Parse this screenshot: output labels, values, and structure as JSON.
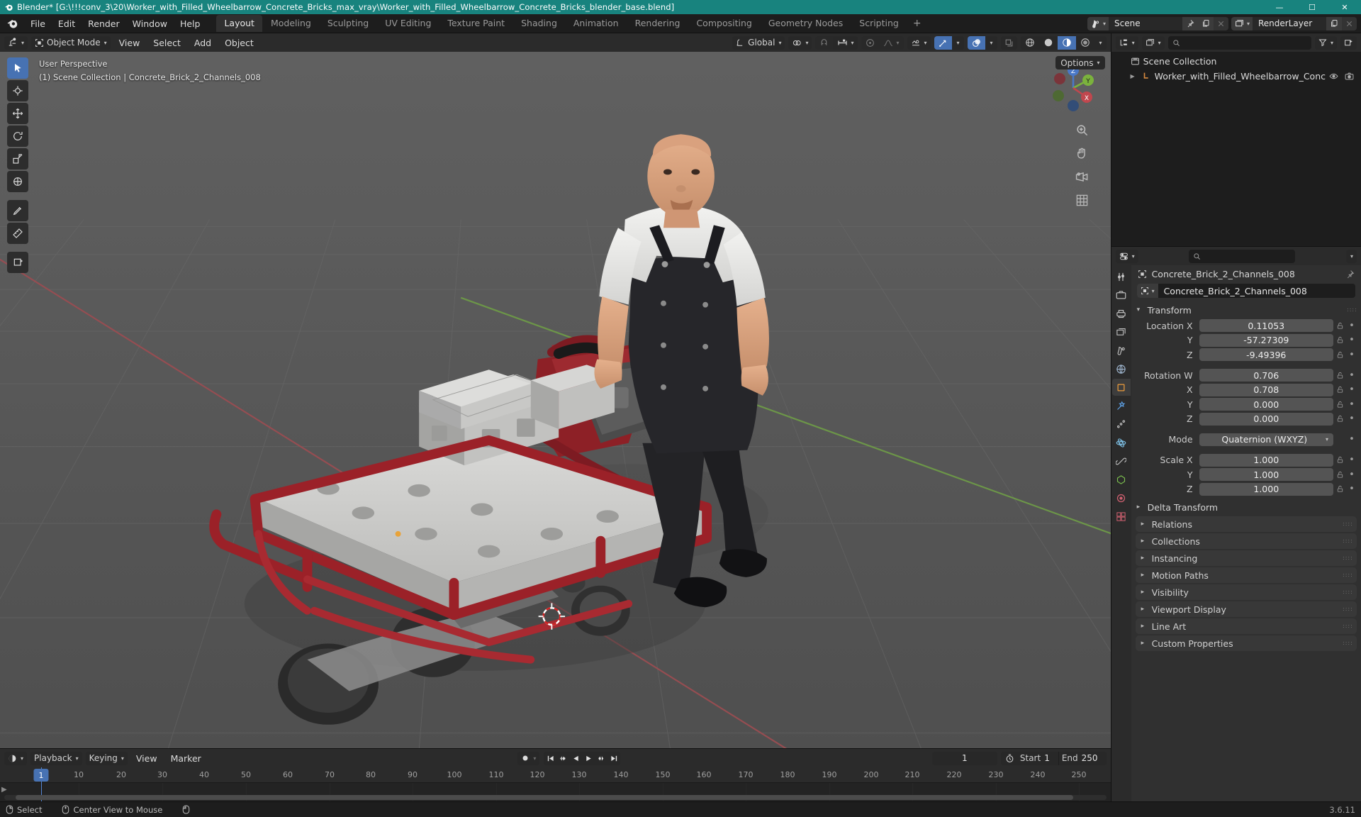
{
  "titlebar": {
    "text": "Blender* [G:\\!!!conv_3\\20\\Worker_with_Filled_Wheelbarrow_Concrete_Bricks_max_vray\\Worker_with_Filled_Wheelbarrow_Concrete_Bricks_blender_base.blend]",
    "minimize": "—",
    "maximize": "☐",
    "close": "✕",
    "accent_color": "#18837e"
  },
  "topbar": {
    "menus": [
      "File",
      "Edit",
      "Render",
      "Window",
      "Help"
    ],
    "tabs": [
      "Layout",
      "Modeling",
      "Sculpting",
      "UV Editing",
      "Texture Paint",
      "Shading",
      "Animation",
      "Rendering",
      "Compositing",
      "Geometry Nodes",
      "Scripting"
    ],
    "active_tab": "Layout",
    "add_tab": "+",
    "scene_name": "Scene",
    "viewlayer_name": "RenderLayer"
  },
  "viewport_header": {
    "mode": "Object Mode",
    "menus": [
      "View",
      "Select",
      "Add",
      "Object"
    ],
    "transform_orientation": "Global",
    "options_label": "Options"
  },
  "viewport": {
    "perspective": "User Perspective",
    "info": "(1) Scene Collection | Concrete_Brick_2_Channels_008",
    "gizmo_axes": {
      "x": "X",
      "y": "Y",
      "z": "Z"
    }
  },
  "outliner": {
    "search_placeholder": "",
    "rows": [
      {
        "label": "Scene Collection",
        "indent": 0,
        "icon": "collection-icon"
      },
      {
        "label": "Worker_with_Filled_Wheelbarrow_Conc",
        "indent": 1,
        "icon": "armature-icon"
      }
    ]
  },
  "properties": {
    "search_placeholder": "",
    "breadcrumb_object": "Concrete_Brick_2_Channels_008",
    "object_name": "Concrete_Brick_2_Channels_008",
    "transform_title": "Transform",
    "fields": [
      {
        "label": "Location X",
        "value": "0.11053"
      },
      {
        "label": "Y",
        "value": "-57.27309"
      },
      {
        "label": "Z",
        "value": "-9.49396"
      }
    ],
    "rotation": [
      {
        "label": "Rotation W",
        "value": "0.706"
      },
      {
        "label": "X",
        "value": "0.708"
      },
      {
        "label": "Y",
        "value": "0.000"
      },
      {
        "label": "Z",
        "value": "0.000"
      }
    ],
    "mode_label": "Mode",
    "mode_value": "Quaternion (WXYZ)",
    "scale": [
      {
        "label": "Scale X",
        "value": "1.000"
      },
      {
        "label": "Y",
        "value": "1.000"
      },
      {
        "label": "Z",
        "value": "1.000"
      }
    ],
    "delta_transform": "Delta Transform",
    "panels": [
      "Relations",
      "Collections",
      "Instancing",
      "Motion Paths",
      "Visibility",
      "Viewport Display",
      "Line Art",
      "Custom Properties"
    ]
  },
  "timeline": {
    "menus": [
      "Playback",
      "Keying",
      "View",
      "Marker"
    ],
    "current_frame": "1",
    "start_label": "Start",
    "start_value": "1",
    "end_label": "End",
    "end_value": "250",
    "ticks": [
      "10",
      "20",
      "30",
      "40",
      "50",
      "60",
      "70",
      "80",
      "90",
      "100",
      "110",
      "120",
      "130",
      "140",
      "150",
      "160",
      "170",
      "180",
      "190",
      "200",
      "210",
      "220",
      "230",
      "240",
      "250"
    ],
    "playhead_label": "1"
  },
  "status": {
    "select": "Select",
    "center_view": "Center View to Mouse",
    "version": "3.6.11"
  }
}
